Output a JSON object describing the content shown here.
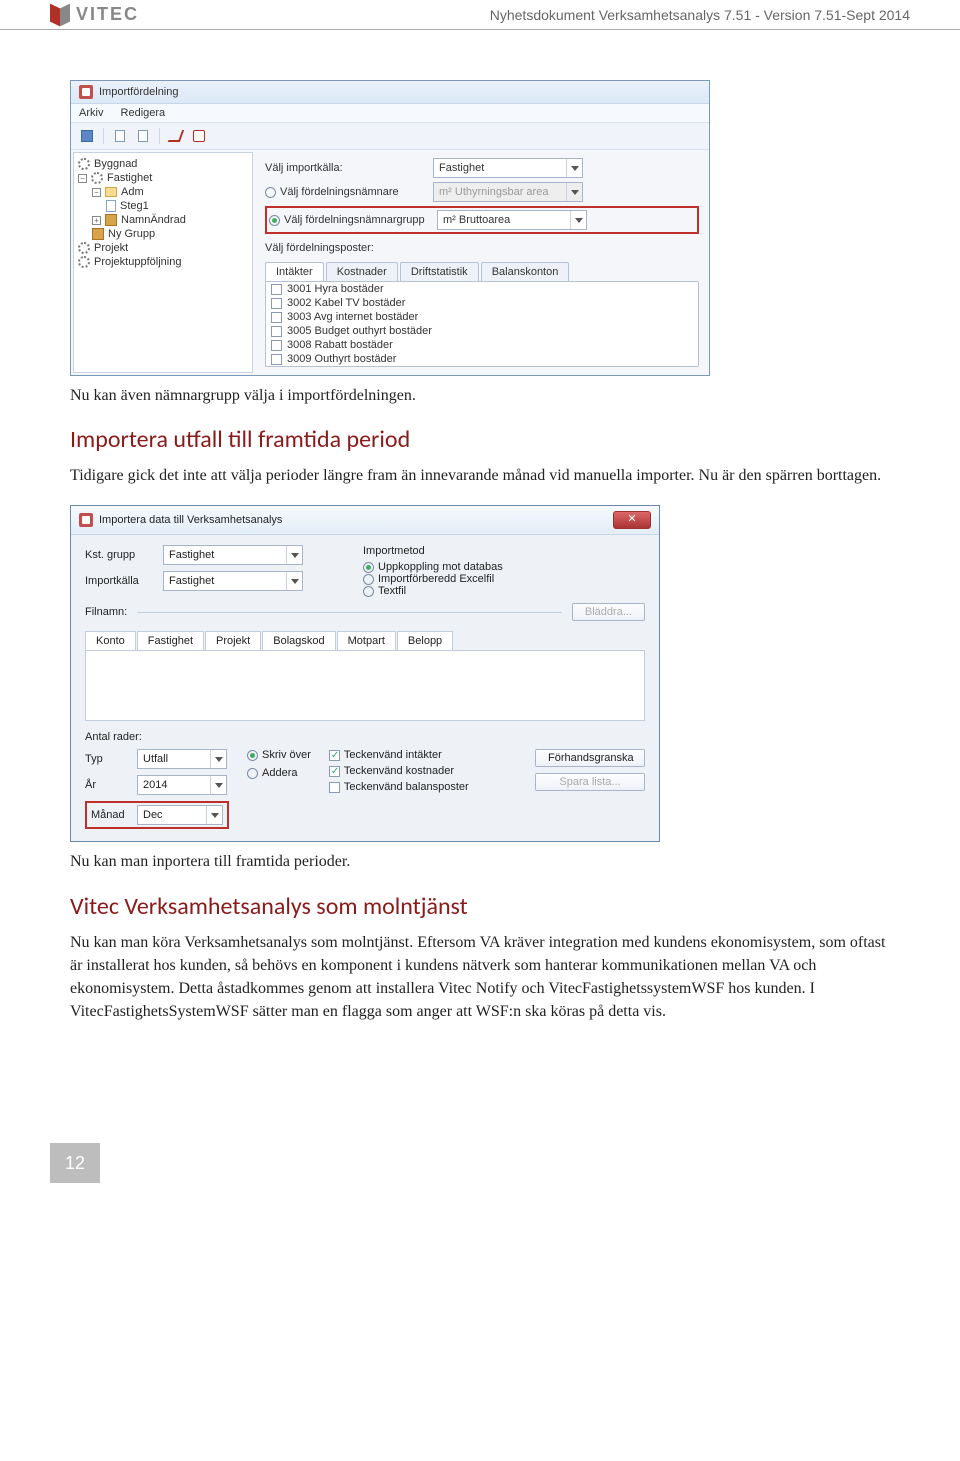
{
  "header": {
    "logo_text": "VITEC",
    "doc_title": "Nyhetsdokument Verksamhetsanalys 7.51 - Version 7.51-Sept 2014"
  },
  "win1": {
    "title": "Importfördelning",
    "menu": {
      "arkiv": "Arkiv",
      "redigera": "Redigera"
    },
    "tree": {
      "byggnad": "Byggnad",
      "fastighet": "Fastighet",
      "adm": "Adm",
      "steg1": "Steg1",
      "namnandrad": "NamnÄndrad",
      "nygrupp": "Ny Grupp",
      "projekt": "Projekt",
      "projektuppfoljning": "Projektuppföljning"
    },
    "form": {
      "valj_importkalla": "Välj importkälla:",
      "valj_fordelningsnamnare": "Välj fördelningsnämnare",
      "valj_fordelningsnamnargrupp": "Välj fördelningsnämnargrupp",
      "valj_fordelningsposter": "Välj fördelningsposter:",
      "dd_fastighet": "Fastighet",
      "dd_uthyrn": "m² Uthyrningsbar area",
      "dd_brutto": "m² Bruttoarea"
    },
    "tabs": {
      "intakter": "Intäkter",
      "kostnader": "Kostnader",
      "driftstatistik": "Driftstatistik",
      "balanskonton": "Balanskonton"
    },
    "list": [
      "3001 Hyra bostäder",
      "3002 Kabel TV bostäder",
      "3003 Avg internet bostäder",
      "3005 Budget outhyrt bostäder",
      "3008 Rabatt bostäder",
      "3009 Outhyrt bostäder"
    ]
  },
  "para1": "Nu kan även nämnargrupp välja i importfördelningen.",
  "h2a": "Importera utfall till framtida period",
  "para2": "Tidigare gick det inte att välja perioder längre fram än innevarande månad vid manuella importer. Nu är den spärren borttagen.",
  "win2": {
    "title": "Importera data till Verksamhetsanalys",
    "kst_grupp_lbl": "Kst. grupp",
    "importkalla_lbl": "Importkälla",
    "kst_grupp_val": "Fastighet",
    "importkalla_val": "Fastighet",
    "importmetod_lbl": "Importmetod",
    "opt_uppkoppling": "Uppkoppling mot databas",
    "opt_excel": "Importförberedd Excelfil",
    "opt_textfil": "Textfil",
    "filnamn_lbl": "Filnamn:",
    "bladdra_btn": "Bläddra...",
    "tabs": {
      "konto": "Konto",
      "fastighet": "Fastighet",
      "projekt": "Projekt",
      "bolagskod": "Bolagskod",
      "motpart": "Motpart",
      "belopp": "Belopp"
    },
    "antal_rader": "Antal rader:",
    "typ_lbl": "Typ",
    "typ_val": "Utfall",
    "ar_lbl": "År",
    "ar_val": "2014",
    "manad_lbl": "Månad",
    "manad_val": "Dec",
    "skriv_over": "Skriv över",
    "addera": "Addera",
    "teck_intakter": "Teckenvänd intäkter",
    "teck_kostnader": "Teckenvänd kostnader",
    "teck_balans": "Teckenvänd balansposter",
    "forhandsgranska": "Förhandsgranska",
    "spara_lista": "Spara lista..."
  },
  "para3": "Nu kan man inportera till framtida perioder.",
  "h2b": "Vitec Verksamhetsanalys som molntjänst",
  "para4": "Nu kan man köra Verksamhetsanalys som molntjänst. Eftersom VA kräver integration med kundens ekonomisystem, som oftast är installerat hos kunden, så behövs en komponent i kundens nätverk som hanterar kommunikationen mellan VA och ekonomisystem. Detta åstadkommes genom att installera Vitec Notify och VitecFastighetssystemWSF hos kunden. I VitecFastighetsSystemWSF sätter man en flagga som anger att WSF:n ska köras på detta vis.",
  "page_number": "12"
}
